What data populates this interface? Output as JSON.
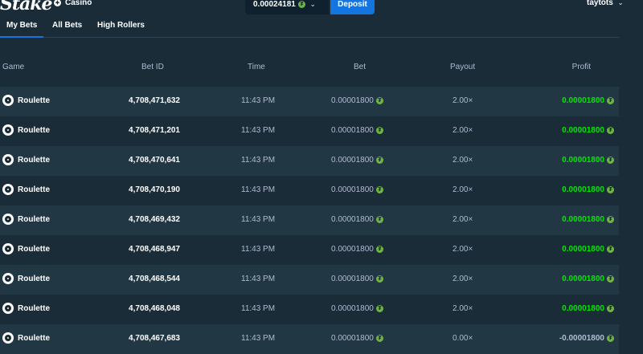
{
  "header": {
    "logo": "Stake",
    "casino_label": "Casino",
    "balance": "0.00024181",
    "deposit_label": "Deposit",
    "username": "taytots"
  },
  "tabs": [
    {
      "label": "My Bets",
      "active": true
    },
    {
      "label": "All Bets",
      "active": false
    },
    {
      "label": "High Rollers",
      "active": false
    }
  ],
  "table": {
    "columns": {
      "game": "Game",
      "bet_id": "Bet ID",
      "time": "Time",
      "bet": "Bet",
      "payout": "Payout",
      "profit": "Profit"
    },
    "rows": [
      {
        "game": "Roulette",
        "bet_id": "4,708,471,632",
        "time": "11:43 PM",
        "bet": "0.00001800",
        "payout": "2.00×",
        "profit": "0.00001800",
        "win": true
      },
      {
        "game": "Roulette",
        "bet_id": "4,708,471,201",
        "time": "11:43 PM",
        "bet": "0.00001800",
        "payout": "2.00×",
        "profit": "0.00001800",
        "win": true
      },
      {
        "game": "Roulette",
        "bet_id": "4,708,470,641",
        "time": "11:43 PM",
        "bet": "0.00001800",
        "payout": "2.00×",
        "profit": "0.00001800",
        "win": true
      },
      {
        "game": "Roulette",
        "bet_id": "4,708,470,190",
        "time": "11:43 PM",
        "bet": "0.00001800",
        "payout": "2.00×",
        "profit": "0.00001800",
        "win": true
      },
      {
        "game": "Roulette",
        "bet_id": "4,708,469,432",
        "time": "11:43 PM",
        "bet": "0.00001800",
        "payout": "2.00×",
        "profit": "0.00001800",
        "win": true
      },
      {
        "game": "Roulette",
        "bet_id": "4,708,468,947",
        "time": "11:43 PM",
        "bet": "0.00001800",
        "payout": "2.00×",
        "profit": "0.00001800",
        "win": true
      },
      {
        "game": "Roulette",
        "bet_id": "4,708,468,544",
        "time": "11:43 PM",
        "bet": "0.00001800",
        "payout": "2.00×",
        "profit": "0.00001800",
        "win": true
      },
      {
        "game": "Roulette",
        "bet_id": "4,708,468,048",
        "time": "11:43 PM",
        "bet": "0.00001800",
        "payout": "2.00×",
        "profit": "0.00001800",
        "win": true
      },
      {
        "game": "Roulette",
        "bet_id": "4,708,467,683",
        "time": "11:43 PM",
        "bet": "0.00001800",
        "payout": "0.00×",
        "profit": "-0.00001800",
        "win": false
      }
    ]
  },
  "colors": {
    "background": "#1a2c38",
    "row_alt": "#213743",
    "accent": "#1475e1",
    "win": "#00e701",
    "muted": "#b1bad3"
  },
  "icons": {
    "game": "roulette-wheel-icon",
    "currency": "coin-icon",
    "casino": "casino-icon",
    "dropdown": "chevron-down-icon"
  }
}
